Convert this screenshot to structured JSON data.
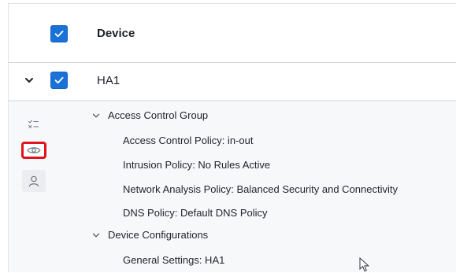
{
  "table": {
    "header": {
      "title": "Device"
    },
    "row": {
      "name": "HA1"
    }
  },
  "details": {
    "sections": [
      {
        "title": "Access Control Group",
        "items": [
          "Access Control Policy: in-out",
          "Intrusion Policy: No Rules Active",
          "Network Analysis Policy: Balanced Security and Connectivity",
          "DNS Policy: Default DNS Policy"
        ]
      },
      {
        "title": "Device Configurations",
        "items": [
          "General Settings: HA1"
        ]
      }
    ]
  },
  "icons": {
    "side": [
      "checklist-icon",
      "eye-icon",
      "user-icon"
    ],
    "highlight_color": "#e0131d",
    "checkbox_color": "#1a72d9"
  }
}
